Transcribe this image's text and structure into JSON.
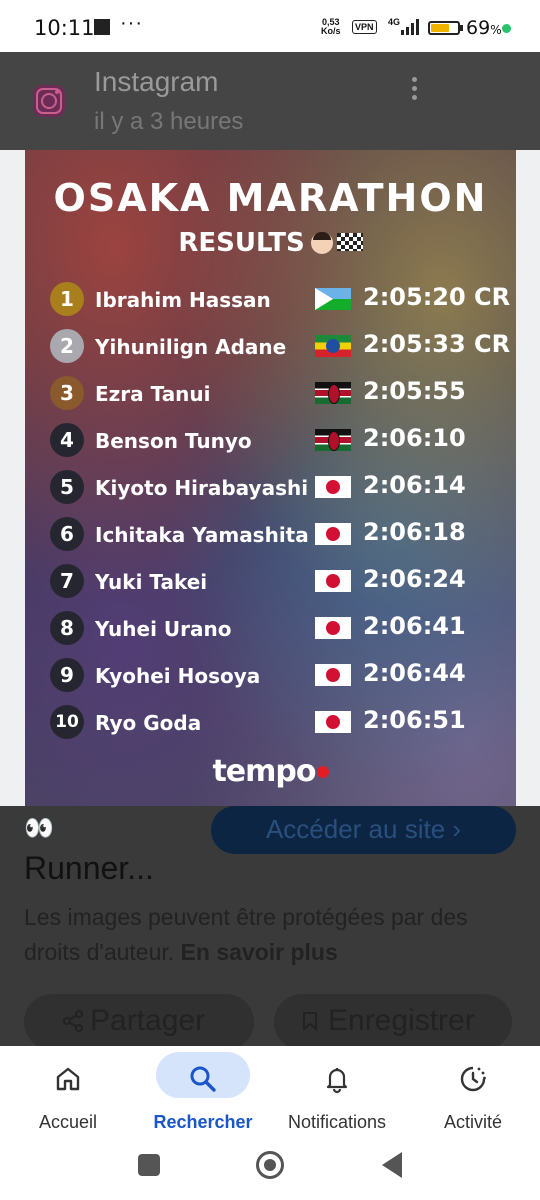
{
  "status_bar": {
    "time": "10:11",
    "network_speed_value": "0,53",
    "network_speed_unit": "Ko/s",
    "vpn": "VPN",
    "network_type": "4G",
    "battery_percent_text": "69",
    "battery_percent_sign": "%",
    "battery_level": 0.69
  },
  "source": {
    "name": "Instagram",
    "time_ago": "il y a 3 heures"
  },
  "poster": {
    "title": "OSAKA MARATHON",
    "subtitle": "RESULTS",
    "brand": "tempo",
    "results": [
      {
        "rank": "1",
        "name": "Ibrahim Hassan",
        "flag": "djibouti-flag",
        "time": "2:05:20 CR",
        "medal": "gold"
      },
      {
        "rank": "2",
        "name": "Yihunilign Adane",
        "flag": "ethiopia-flag",
        "time": "2:05:33 CR",
        "medal": "silver"
      },
      {
        "rank": "3",
        "name": "Ezra Tanui",
        "flag": "kenya-flag",
        "time": "2:05:55",
        "medal": "bronze"
      },
      {
        "rank": "4",
        "name": "Benson Tunyo",
        "flag": "kenya-flag",
        "time": "2:06:10",
        "medal": ""
      },
      {
        "rank": "5",
        "name": "Kiyoto Hirabayashi",
        "flag": "japan-flag",
        "time": "2:06:14",
        "medal": ""
      },
      {
        "rank": "6",
        "name": "Ichitaka Yamashita",
        "flag": "japan-flag",
        "time": "2:06:18",
        "medal": ""
      },
      {
        "rank": "7",
        "name": "Yuki Takei",
        "flag": "japan-flag",
        "time": "2:06:24",
        "medal": ""
      },
      {
        "rank": "8",
        "name": "Yuhei Urano",
        "flag": "japan-flag",
        "time": "2:06:41",
        "medal": ""
      },
      {
        "rank": "9",
        "name": "Kyohei Hosoya",
        "flag": "japan-flag",
        "time": "2:06:44",
        "medal": ""
      },
      {
        "rank": "10",
        "name": "Ryo Goda",
        "flag": "japan-flag",
        "time": "2:06:51",
        "medal": ""
      }
    ]
  },
  "details": {
    "visit_button": "Accéder au site ›",
    "title": "Runner...",
    "notice": "Les images peuvent être protégées par des droits d'auteur.",
    "learn_more": "En savoir plus",
    "share_label": "Partager",
    "save_label": "Enregistrer"
  },
  "bottom_nav": [
    {
      "label": "Accueil",
      "icon": "home-icon",
      "active": false
    },
    {
      "label": "Rechercher",
      "icon": "search-icon",
      "active": true
    },
    {
      "label": "Notifications",
      "icon": "bell-icon",
      "active": false
    },
    {
      "label": "Activité",
      "icon": "activity-icon",
      "active": false
    }
  ],
  "colors": {
    "active_nav": "#1a56c9",
    "active_nav_pill": "#d5e3fb",
    "gold": "#a97e1c",
    "silver": "#a8a8ae",
    "bronze": "#8a5a2c",
    "brand_dot": "#e21d25"
  }
}
